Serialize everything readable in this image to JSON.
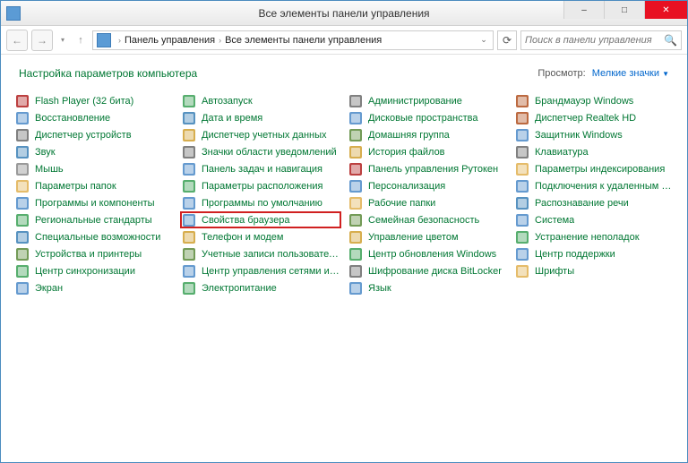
{
  "window": {
    "title": "Все элементы панели управления",
    "minimize": "–",
    "maximize": "□",
    "close": "✕"
  },
  "nav": {
    "back": "←",
    "forward": "→",
    "history": "▾",
    "up": "↑",
    "refresh": "⟳",
    "breadcrumb": {
      "seg1": "Панель управления",
      "seg2": "Все элементы панели управления"
    },
    "search_placeholder": "Поиск в панели управления",
    "search_icon": "🔍"
  },
  "header": {
    "title": "Настройка параметров компьютера",
    "viewby_label": "Просмотр:",
    "viewby_value": "Мелкие значки"
  },
  "icon_colors": {
    "flash": "#b01f1f",
    "recovery": "#4a88c7",
    "devmgr": "#6a6a6a",
    "sound": "#3a7fb5",
    "mouse": "#888",
    "folder": "#e0b050",
    "programs": "#4a88c7",
    "region": "#3aa055",
    "access": "#3a7fb5",
    "devprint": "#5a8a3a",
    "sync": "#3aa055",
    "display": "#4a88c7",
    "autoplay": "#3aa055",
    "datetime": "#3a7fb5",
    "credmgr": "#d0a030",
    "notif": "#6a6a6a",
    "taskbar": "#4a88c7",
    "location": "#3aa055",
    "defprog": "#4a88c7",
    "inetopt": "#4a88c7",
    "phone": "#d0a030",
    "users": "#5a8a3a",
    "network": "#4a88c7",
    "power": "#3aa055",
    "admin": "#6a6a6a",
    "storage": "#4a88c7",
    "homegroup": "#5a8a3a",
    "history2": "#d0a030",
    "rutoken": "#b01f1f",
    "personal": "#4a88c7",
    "workfolders": "#e0b050",
    "family": "#5a8a3a",
    "color": "#d0a030",
    "update": "#3aa055",
    "bitlocker": "#6a6a6a",
    "lang": "#4a88c7",
    "firewall": "#b05020",
    "realtek": "#b05020",
    "defender": "#4a88c7",
    "keyboard": "#6a6a6a",
    "index": "#e0b050",
    "remote": "#4a88c7",
    "speech": "#3a7fb5",
    "system": "#4a88c7",
    "trouble": "#3aa055",
    "support": "#4a88c7",
    "fonts": "#e0b050"
  },
  "items": [
    [
      {
        "id": "flash",
        "label": "Flash Player (32 бита)",
        "ic": "flash"
      },
      {
        "id": "recovery",
        "label": "Восстановление",
        "ic": "recovery"
      },
      {
        "id": "devmgr",
        "label": "Диспетчер устройств",
        "ic": "devmgr"
      },
      {
        "id": "sound",
        "label": "Звук",
        "ic": "sound"
      },
      {
        "id": "mouse",
        "label": "Мышь",
        "ic": "mouse"
      },
      {
        "id": "folderopt",
        "label": "Параметры папок",
        "ic": "folder"
      },
      {
        "id": "programs",
        "label": "Программы и компоненты",
        "ic": "programs"
      },
      {
        "id": "region",
        "label": "Региональные стандарты",
        "ic": "region"
      },
      {
        "id": "access",
        "label": "Специальные возможности",
        "ic": "access"
      },
      {
        "id": "devprint",
        "label": "Устройства и принтеры",
        "ic": "devprint"
      },
      {
        "id": "sync",
        "label": "Центр синхронизации",
        "ic": "sync"
      },
      {
        "id": "display",
        "label": "Экран",
        "ic": "display"
      }
    ],
    [
      {
        "id": "autoplay",
        "label": "Автозапуск",
        "ic": "autoplay"
      },
      {
        "id": "datetime",
        "label": "Дата и время",
        "ic": "datetime"
      },
      {
        "id": "credmgr",
        "label": "Диспетчер учетных данных",
        "ic": "credmgr"
      },
      {
        "id": "notif",
        "label": "Значки области уведомлений",
        "ic": "notif"
      },
      {
        "id": "taskbar",
        "label": "Панель задач и навигация",
        "ic": "taskbar"
      },
      {
        "id": "location",
        "label": "Параметры расположения",
        "ic": "location"
      },
      {
        "id": "defprog",
        "label": "Программы по умолчанию",
        "ic": "defprog"
      },
      {
        "id": "inetopt",
        "label": "Свойства браузера",
        "ic": "inetopt",
        "highlight": true
      },
      {
        "id": "phone",
        "label": "Телефон и модем",
        "ic": "phone"
      },
      {
        "id": "users",
        "label": "Учетные записи пользователей",
        "ic": "users"
      },
      {
        "id": "network",
        "label": "Центр управления сетями и общи...",
        "ic": "network"
      },
      {
        "id": "power",
        "label": "Электропитание",
        "ic": "power"
      }
    ],
    [
      {
        "id": "admin",
        "label": "Администрирование",
        "ic": "admin"
      },
      {
        "id": "storage",
        "label": "Дисковые пространства",
        "ic": "storage"
      },
      {
        "id": "homegroup",
        "label": "Домашняя группа",
        "ic": "homegroup"
      },
      {
        "id": "history",
        "label": "История файлов",
        "ic": "history2"
      },
      {
        "id": "rutoken",
        "label": "Панель управления Рутокен",
        "ic": "rutoken"
      },
      {
        "id": "personal",
        "label": "Персонализация",
        "ic": "personal"
      },
      {
        "id": "workfolders",
        "label": "Рабочие папки",
        "ic": "workfolders"
      },
      {
        "id": "family",
        "label": "Семейная безопасность",
        "ic": "family"
      },
      {
        "id": "color",
        "label": "Управление цветом",
        "ic": "color"
      },
      {
        "id": "update",
        "label": "Центр обновления Windows",
        "ic": "update"
      },
      {
        "id": "bitlocker",
        "label": "Шифрование диска BitLocker",
        "ic": "bitlocker"
      },
      {
        "id": "lang",
        "label": "Язык",
        "ic": "lang"
      }
    ],
    [
      {
        "id": "firewall",
        "label": "Брандмауэр Windows",
        "ic": "firewall"
      },
      {
        "id": "realtek",
        "label": "Диспетчер Realtek HD",
        "ic": "realtek"
      },
      {
        "id": "defender",
        "label": "Защитник Windows",
        "ic": "defender"
      },
      {
        "id": "keyboard",
        "label": "Клавиатура",
        "ic": "keyboard"
      },
      {
        "id": "index",
        "label": "Параметры индексирования",
        "ic": "index"
      },
      {
        "id": "remote",
        "label": "Подключения к удаленным рабоч...",
        "ic": "remote"
      },
      {
        "id": "speech",
        "label": "Распознавание речи",
        "ic": "speech"
      },
      {
        "id": "system",
        "label": "Система",
        "ic": "system"
      },
      {
        "id": "trouble",
        "label": "Устранение неполадок",
        "ic": "trouble"
      },
      {
        "id": "support",
        "label": "Центр поддержки",
        "ic": "support"
      },
      {
        "id": "fonts",
        "label": "Шрифты",
        "ic": "fonts"
      }
    ]
  ]
}
